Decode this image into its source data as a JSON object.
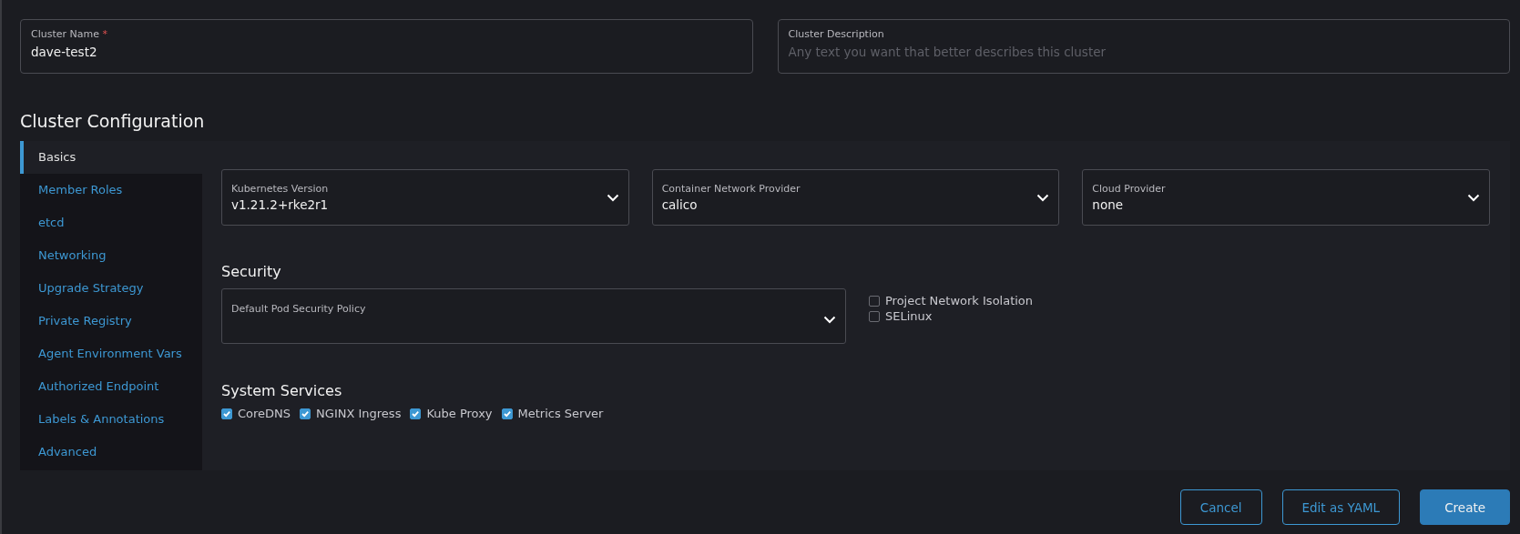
{
  "cluster_name": {
    "label": "Cluster Name",
    "required_mark": "*",
    "value": "dave-test2"
  },
  "cluster_description": {
    "label": "Cluster Description",
    "placeholder": "Any text you want that better describes this cluster"
  },
  "section_title": "Cluster Configuration",
  "sidebar": {
    "items": [
      {
        "label": "Basics",
        "selected": true
      },
      {
        "label": "Member Roles",
        "selected": false
      },
      {
        "label": "etcd",
        "selected": false
      },
      {
        "label": "Networking",
        "selected": false
      },
      {
        "label": "Upgrade Strategy",
        "selected": false
      },
      {
        "label": "Private Registry",
        "selected": false
      },
      {
        "label": "Agent Environment Vars",
        "selected": false
      },
      {
        "label": "Authorized Endpoint",
        "selected": false
      },
      {
        "label": "Labels & Annotations",
        "selected": false
      },
      {
        "label": "Advanced",
        "selected": false
      }
    ]
  },
  "basics": {
    "selects": [
      {
        "label": "Kubernetes Version",
        "value": "v1.21.2+rke2r1"
      },
      {
        "label": "Container Network Provider",
        "value": "calico"
      },
      {
        "label": "Cloud Provider",
        "value": "none"
      }
    ],
    "security": {
      "title": "Security",
      "pod_policy": {
        "label": "Default Pod Security Policy"
      },
      "options": [
        {
          "label": "Project Network Isolation",
          "checked": false
        },
        {
          "label": "SELinux",
          "checked": false
        }
      ]
    },
    "system_services": {
      "title": "System Services",
      "options": [
        {
          "label": "CoreDNS",
          "checked": true
        },
        {
          "label": "NGINX Ingress",
          "checked": true
        },
        {
          "label": "Kube Proxy",
          "checked": true
        },
        {
          "label": "Metrics Server",
          "checked": true
        }
      ]
    }
  },
  "buttons": [
    {
      "label": "Cancel",
      "kind": "outline"
    },
    {
      "label": "Edit as YAML",
      "kind": "outline"
    },
    {
      "label": "Create",
      "kind": "primary"
    }
  ]
}
